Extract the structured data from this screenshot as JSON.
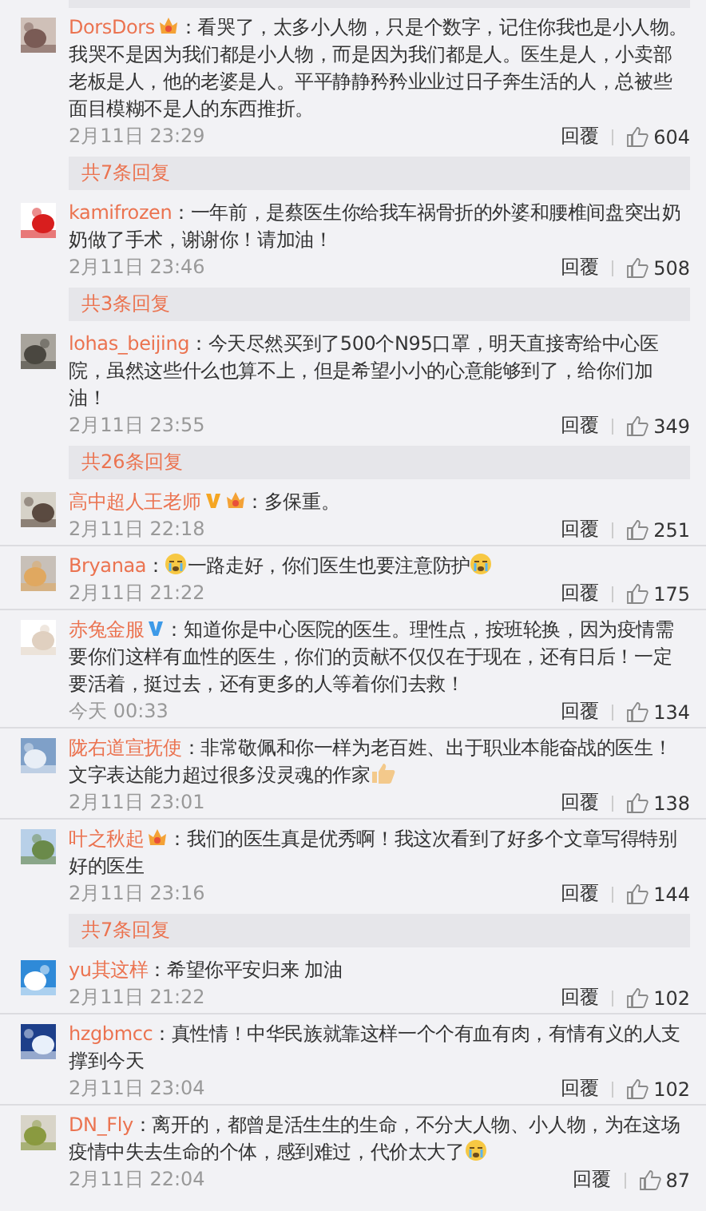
{
  "comments": [
    {
      "name": "DorsDors",
      "badges": [
        {
          "kind": "crown"
        }
      ],
      "segments": [
        {
          "kind": "text",
          "text": "：看哭了，太多小人物，只是个数字，记住你我也是小人物。我哭不是因为我们都是小人物，而是因为我们都是人。医生是人，小卖部老板是人，他的老婆是人。平平静静矜矜业业过日子奔生活的人，总被些面目模糊不是人的东西推折。"
        }
      ],
      "time": "2月11日 23:29",
      "reply": "回覆",
      "likes": "604",
      "thread": "共7条回复"
    },
    {
      "name": "kamifrozen",
      "segments": [
        {
          "kind": "text",
          "text": "：一年前，是蔡医生你给我车祸骨折的外婆和腰椎间盘突出奶奶做了手术，谢谢你！请加油！"
        }
      ],
      "time": "2月11日 23:46",
      "reply": "回覆",
      "likes": "508",
      "thread": "共3条回复"
    },
    {
      "name": "lohas_beijing",
      "segments": [
        {
          "kind": "text",
          "text": "：今天尽然买到了500个N95口罩，明天直接寄给中心医院，虽然这些什么也算不上，但是希望小小的心意能够到了，给你们加油！"
        }
      ],
      "time": "2月11日 23:55",
      "reply": "回覆",
      "likes": "349",
      "thread": "共26条回复"
    },
    {
      "name": "高中超人王老师",
      "badges": [
        {
          "kind": "gold-v"
        },
        {
          "kind": "crown"
        }
      ],
      "segments": [
        {
          "kind": "text",
          "text": "：多保重。"
        }
      ],
      "time": "2月11日 22:18",
      "reply": "回覆",
      "likes": "251"
    },
    {
      "name": "Bryanaa",
      "segments": [
        {
          "kind": "text",
          "text": "："
        },
        {
          "kind": "cry"
        },
        {
          "kind": "text",
          "text": "一路走好，你们医生也要注意防护"
        },
        {
          "kind": "cry"
        }
      ],
      "time": "2月11日 21:22",
      "reply": "回覆",
      "likes": "175"
    },
    {
      "name": "赤兔金服",
      "badges": [
        {
          "kind": "blue-v"
        }
      ],
      "segments": [
        {
          "kind": "text",
          "text": "：知道你是中心医院的医生。理性点，按班轮换，因为疫情需要你们这样有血性的医生，你们的贡献不仅仅在于现在，还有日后！一定要活着，挺过去，还有更多的人等着你们去救！"
        }
      ],
      "time": "今天 00:33",
      "reply": "回覆",
      "likes": "134"
    },
    {
      "name": "陇右道宣抚使",
      "segments": [
        {
          "kind": "text",
          "text": "：非常敬佩和你一样为老百姓、出于职业本能奋战的医生！文字表达能力超过很多没灵魂的作家"
        },
        {
          "kind": "thumb"
        }
      ],
      "time": "2月11日 23:01",
      "reply": "回覆",
      "likes": "138"
    },
    {
      "name": "叶之秋起",
      "badges": [
        {
          "kind": "crown"
        }
      ],
      "segments": [
        {
          "kind": "text",
          "text": "：我们的医生真是优秀啊！我这次看到了好多个文章写得特别好的医生"
        }
      ],
      "time": "2月11日 23:16",
      "reply": "回覆",
      "likes": "144",
      "thread": "共7条回复"
    },
    {
      "name": "yu其这样",
      "segments": [
        {
          "kind": "text",
          "text": "：希望你平安归来 加油"
        }
      ],
      "time": "2月11日 21:22",
      "reply": "回覆",
      "likes": "102"
    },
    {
      "name": "hzgbmcc",
      "segments": [
        {
          "kind": "text",
          "text": "：真性情！中华民族就靠这样一个个有血有肉，有情有义的人支撑到今天"
        }
      ],
      "time": "2月11日 23:04",
      "reply": "回覆",
      "likes": "102"
    },
    {
      "name": "DN_Fly",
      "segments": [
        {
          "kind": "text",
          "text": "：离开的，都曾是活生生的生命，不分大人物、小人物，为在这场疫情中失去生命的个体，感到难过，代价太大了"
        },
        {
          "kind": "cry"
        }
      ],
      "time": "2月11日 22:04",
      "reply": "回覆",
      "likes": "87"
    }
  ]
}
